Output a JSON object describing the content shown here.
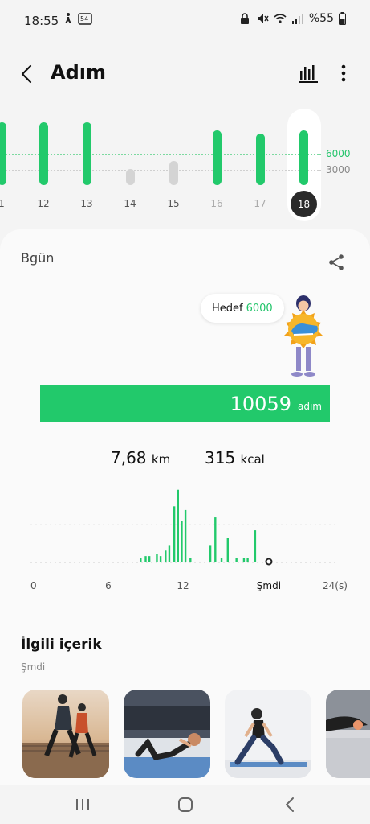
{
  "status_bar": {
    "time": "18:55",
    "battery": "%55",
    "icons_left": [
      "person-walk-icon",
      "calendar-54-icon"
    ],
    "icons_right": [
      "lock-icon",
      "mute-icon",
      "wifi-icon",
      "signal-icon",
      "battery-icon"
    ],
    "calendar_badge": "54"
  },
  "app_bar": {
    "title": "Adım",
    "back_icon": "chevron-left-icon",
    "chart_icon": "bar-chart-icon",
    "more_icon": "more-vert-icon"
  },
  "week_strip": {
    "goal_label": "6000",
    "half_goal_label": "3000",
    "days": [
      {
        "label": "1",
        "level": 0.97,
        "reached": true
      },
      {
        "label": "12",
        "level": 0.97,
        "reached": true
      },
      {
        "label": "13",
        "level": 0.97,
        "reached": true
      },
      {
        "label": "14",
        "level": 0.25,
        "reached": false
      },
      {
        "label": "15",
        "level": 0.37,
        "reached": false
      },
      {
        "label": "16",
        "level": 0.85,
        "reached": true
      },
      {
        "label": "17",
        "level": 0.8,
        "reached": true
      },
      {
        "label": "18",
        "level": 0.85,
        "reached": true,
        "selected": true
      }
    ],
    "colors": {
      "reached": "#22c96b",
      "not_reached": "#d4d4d4",
      "goal_text": "#22c46a",
      "half_goal_text": "#888888"
    }
  },
  "today": {
    "label": "Bgün",
    "share_icon": "share-icon",
    "goal_text": "Hedef",
    "goal_value": "6000",
    "steps_value": "10059",
    "steps_unit": "adım",
    "distance_value": "7,68",
    "distance_unit": "km",
    "calories_value": "315",
    "calories_unit": "kcal",
    "accent": "#22c96b"
  },
  "chart_data": {
    "type": "bar",
    "xlabel": "",
    "ylabel": "",
    "x_ticks": [
      "0",
      "6",
      "12",
      "Şmdi",
      "24(s)"
    ],
    "grid": true,
    "x": [
      8.6,
      9.0,
      9.3,
      9.9,
      10.2,
      10.6,
      10.9,
      11.3,
      11.6,
      11.9,
      12.2,
      12.6,
      14.2,
      14.6,
      15.1,
      15.6,
      16.3,
      16.9,
      17.2,
      17.8
    ],
    "values": [
      2,
      3,
      3,
      4,
      3,
      6,
      9,
      30,
      39,
      22,
      28,
      2,
      9,
      24,
      2,
      13,
      2,
      2,
      2,
      17
    ]
  },
  "related": {
    "title": "İlgili içerik",
    "subtitle": "Şmdi"
  },
  "nav_bar": {
    "recents_icon": "recents-icon",
    "home_icon": "home-icon",
    "back_icon": "back-icon"
  }
}
